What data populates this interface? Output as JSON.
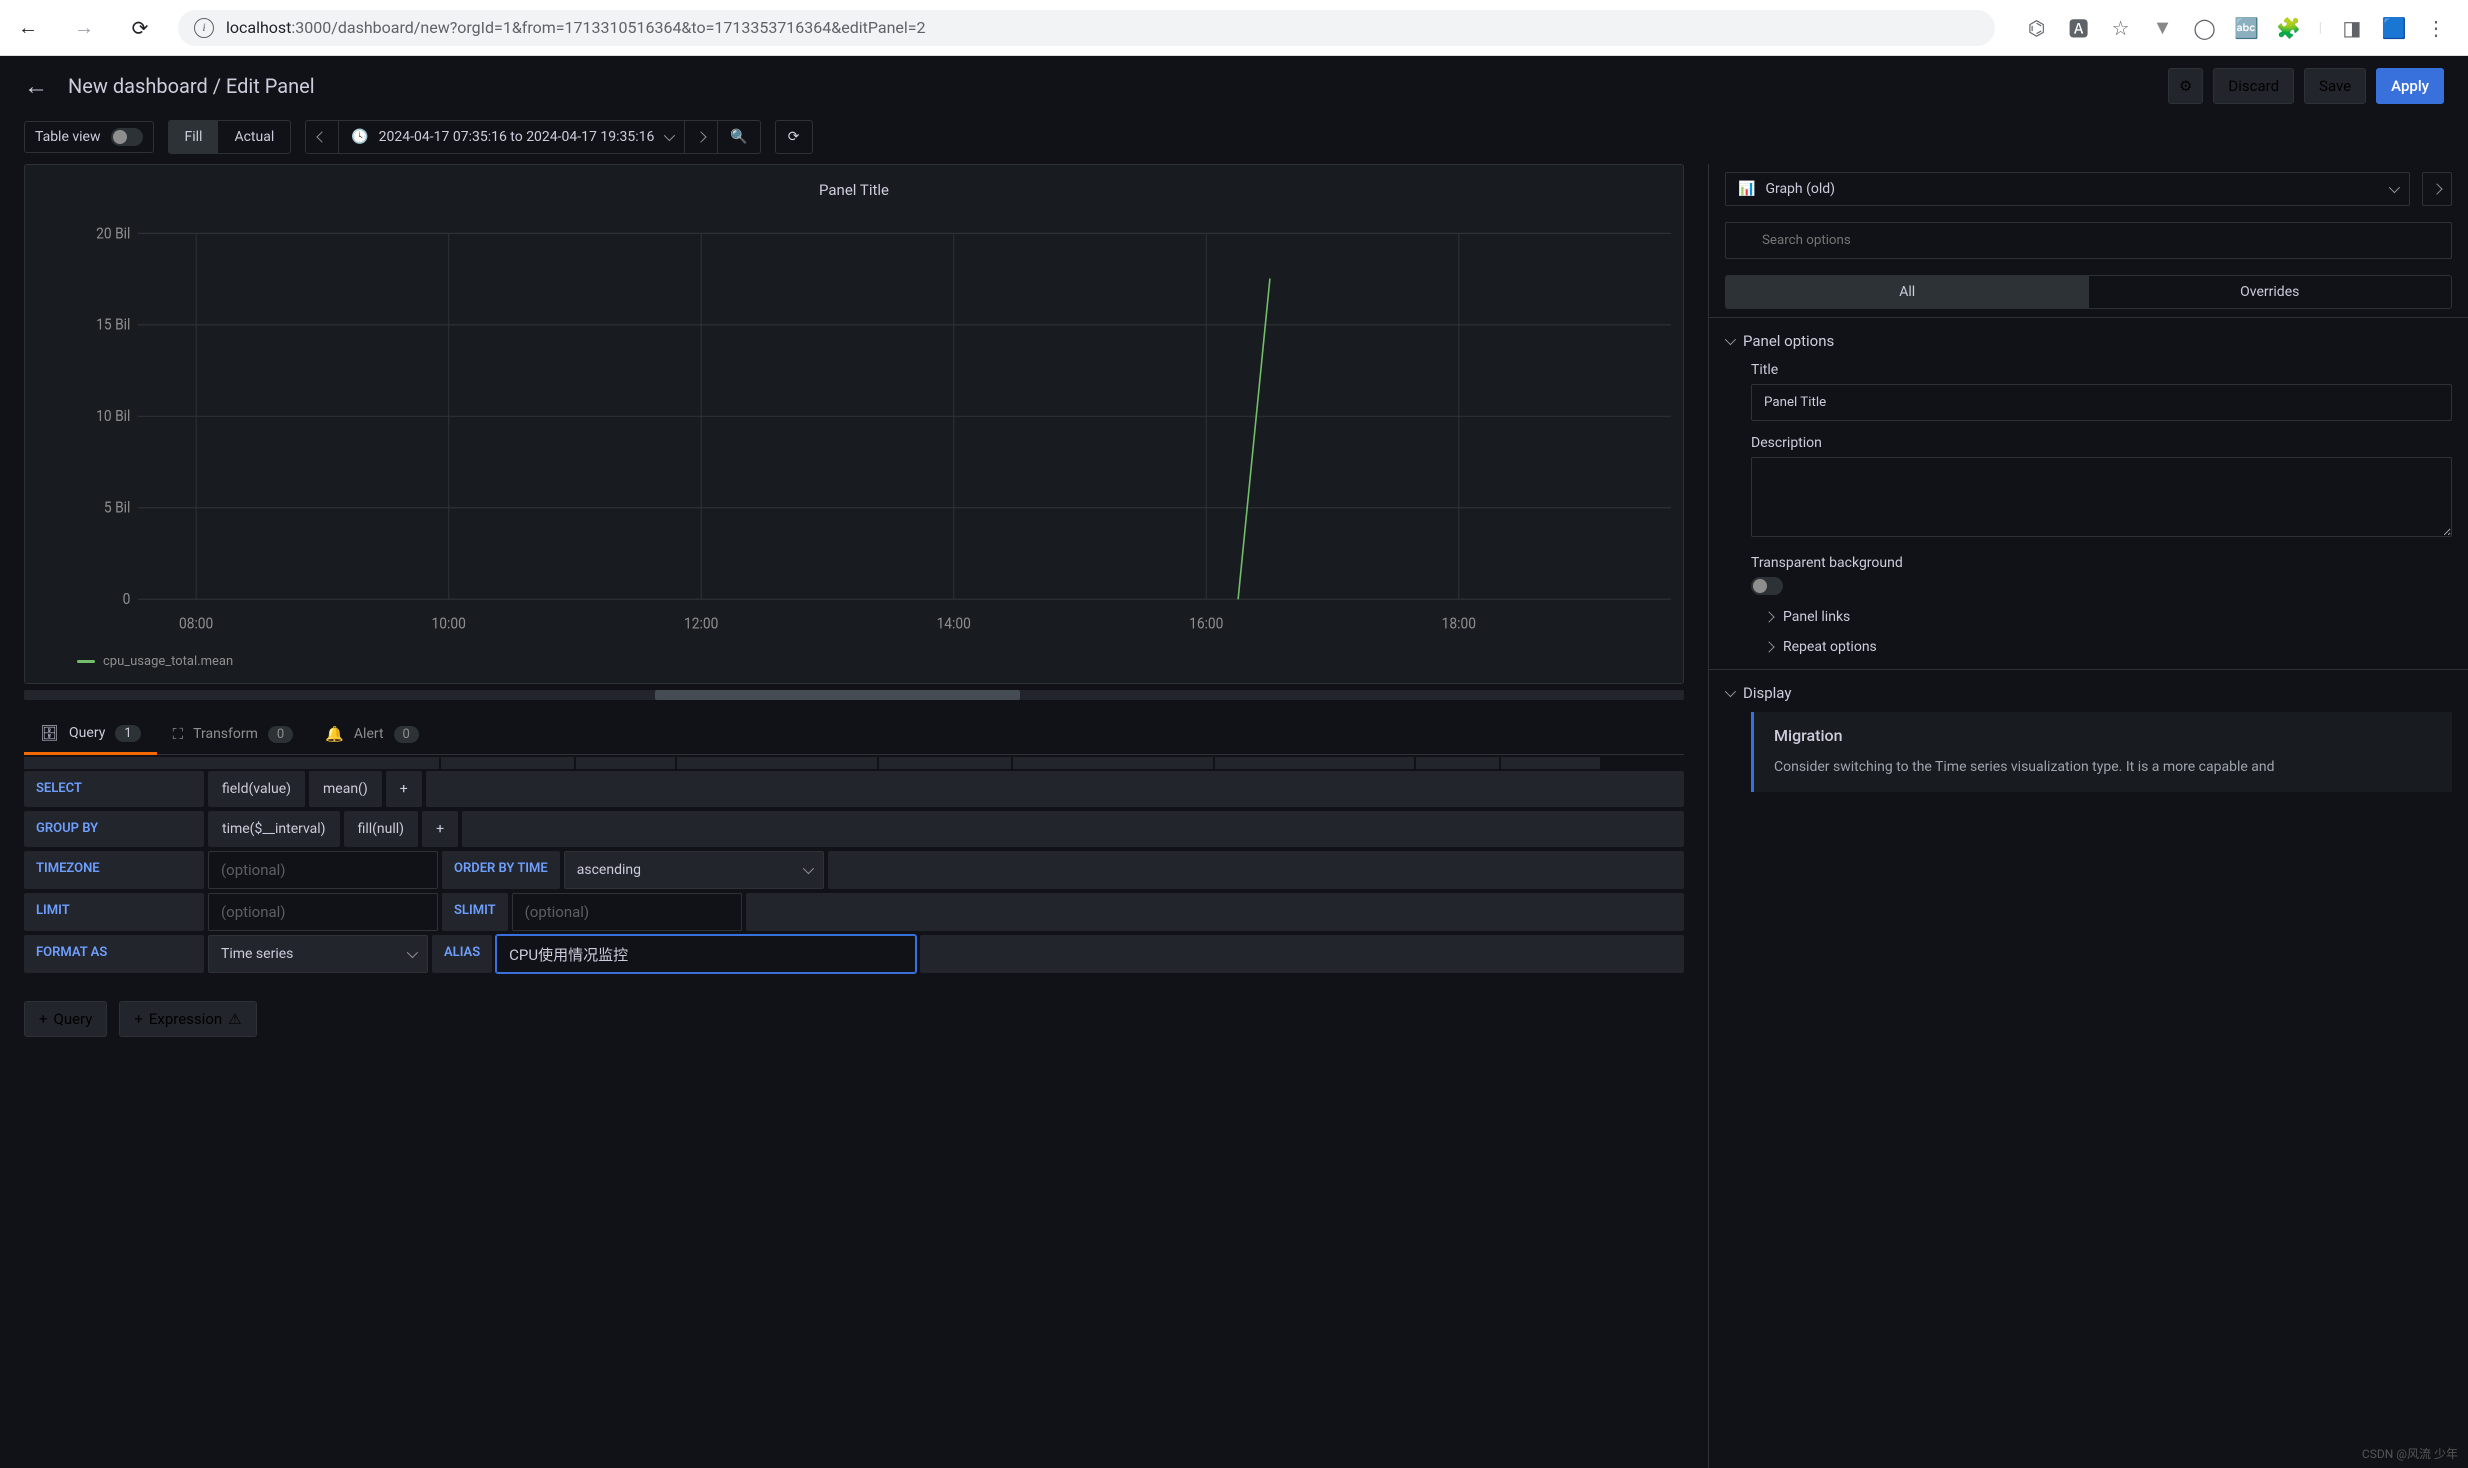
{
  "browser": {
    "url_host": "localhost",
    "url_path": ":3000/dashboard/new?orgId=1&from=1713310516364&to=1713353716364&editPanel=2"
  },
  "header": {
    "title": "New dashboard / Edit Panel",
    "discard": "Discard",
    "save": "Save",
    "apply": "Apply"
  },
  "toolbar": {
    "table_view": "Table view",
    "fill": "Fill",
    "actual": "Actual",
    "time_range": "2024-04-17 07:35:16 to 2024-04-17 19:35:16"
  },
  "chart_data": {
    "type": "line",
    "title": "Panel Title",
    "ylabel": "",
    "xlabel": "",
    "ylim": [
      0,
      20000000000
    ],
    "y_ticks": [
      "0",
      "5 Bil",
      "10 Bil",
      "15 Bil",
      "20 Bil"
    ],
    "x_ticks": [
      "08:00",
      "10:00",
      "12:00",
      "14:00",
      "16:00",
      "18:00"
    ],
    "series": [
      {
        "name": "cpu_usage_total.mean",
        "color": "#73bf69",
        "x": [
          "16:15",
          "16:30"
        ],
        "values": [
          0,
          17500000000
        ]
      }
    ]
  },
  "tabs": {
    "query": {
      "label": "Query",
      "count": "1"
    },
    "transform": {
      "label": "Transform",
      "count": "0"
    },
    "alert": {
      "label": "Alert",
      "count": "0"
    }
  },
  "query": {
    "select_label": "SELECT",
    "select_field": "field(value)",
    "select_agg": "mean()",
    "plus": "+",
    "groupby_label": "GROUP BY",
    "groupby_time": "time($__interval)",
    "groupby_fill": "fill(null)",
    "timezone_label": "TIMEZONE",
    "optional_ph": "(optional)",
    "orderby_label": "ORDER BY TIME",
    "orderby_value": "ascending",
    "limit_label": "LIMIT",
    "slimit_label": "SLIMIT",
    "format_label": "FORMAT AS",
    "format_value": "Time series",
    "alias_label": "ALIAS",
    "alias_value": "CPU使用情况监控"
  },
  "bottom": {
    "add_query": "Query",
    "add_expression": "Expression"
  },
  "right": {
    "viz_type": "Graph (old)",
    "search_ph": "Search options",
    "tab_all": "All",
    "tab_overrides": "Overrides",
    "sections": {
      "panel_options": "Panel options",
      "title_label": "Title",
      "title_value": "Panel Title",
      "desc_label": "Description",
      "transparent_label": "Transparent background",
      "panel_links": "Panel links",
      "repeat_options": "Repeat options",
      "display": "Display",
      "migration_title": "Migration",
      "migration_text": "Consider switching to the Time series visualization type. It is a more capable and"
    }
  },
  "watermark": "CSDN @风流 少年"
}
